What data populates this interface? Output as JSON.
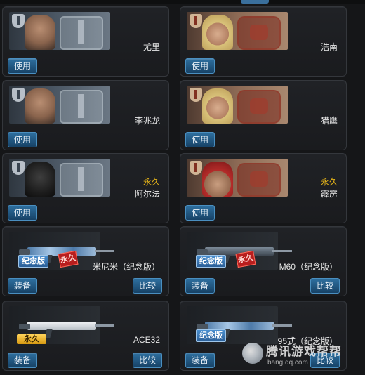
{
  "buttons": {
    "use": "使用",
    "equip": "装备",
    "compare": "比较"
  },
  "badges": {
    "commemorative": "纪念版",
    "permanent_stamp": "永久",
    "permanent_tag": "永久"
  },
  "characters": [
    {
      "name": "尤里",
      "duration": "",
      "faction": "blue",
      "face": "dark-hair"
    },
    {
      "name": "浩南",
      "duration": "",
      "faction": "red",
      "face": "blond"
    },
    {
      "name": "李兆龙",
      "duration": "",
      "faction": "blue",
      "face": "dark-hair"
    },
    {
      "name": "猎鹰",
      "duration": "",
      "faction": "red",
      "face": "blond"
    },
    {
      "name": "阿尔法",
      "duration": "永久",
      "faction": "blue",
      "face": "masked"
    },
    {
      "name": "霹雳",
      "duration": "永久",
      "faction": "red",
      "face": "beret"
    }
  ],
  "weapons": [
    {
      "name": "米尼米（纪念版）",
      "commemorative": true,
      "stamp": true,
      "style": "camo"
    },
    {
      "name": "M60（纪念版）",
      "commemorative": true,
      "stamp": true,
      "style": "dark"
    },
    {
      "name": "ACE32",
      "commemorative": false,
      "stamp": false,
      "style": "white"
    },
    {
      "name": "95式（纪念版）",
      "commemorative": true,
      "stamp": false,
      "style": "camo"
    }
  ],
  "watermark": {
    "title": "腾讯游戏帮帮",
    "url": "bang.qq.com"
  },
  "colors": {
    "accent_button": "#2e6f9f",
    "duration_text": "#e3b219",
    "stamp_red": "#b81e1e"
  }
}
